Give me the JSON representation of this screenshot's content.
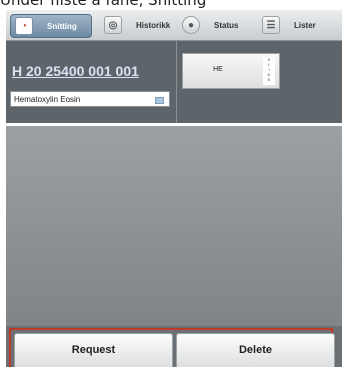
{
  "caption": "Under fliste a fane, Snitting",
  "tabs": [
    {
      "label": "Snitting",
      "icon": "clock-pie-icon",
      "active": true
    },
    {
      "label": "Historikk",
      "icon": "target-icon",
      "active": false
    },
    {
      "label": "Status",
      "icon": "circle-icon",
      "active": false
    },
    {
      "label": "Lister",
      "icon": "list-icon",
      "active": false
    }
  ],
  "case": {
    "id": "H 20 25400 001 001",
    "stain": "Hematoxylin Eosin"
  },
  "slide": {
    "label": "HE",
    "strip_text": "SLIDE"
  },
  "actions": {
    "request_label": "Request",
    "delete_label": "Delete"
  },
  "colors": {
    "accent_frame": "#c0392b",
    "link": "#d6e3f3"
  }
}
